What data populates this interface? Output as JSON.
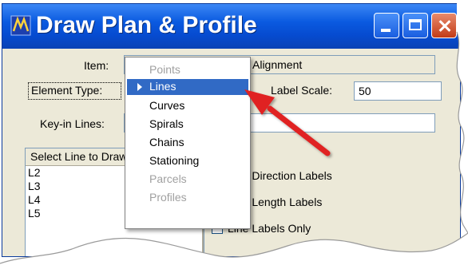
{
  "window": {
    "title": "Draw Plan & Profile",
    "icon": "app-logo-icon",
    "controls": [
      "minimize-icon",
      "maximize-icon",
      "close-icon"
    ]
  },
  "form": {
    "item_label": "Item:",
    "item_value": "Alignment",
    "element_type_label": "Element Type:",
    "label_scale_label": "Label Scale:",
    "label_scale_value": "50",
    "keyin_lines_label": "Key-in Lines:",
    "keyin_lines_value": ""
  },
  "list": {
    "header": "Select Line to Draw",
    "items": [
      "L2",
      "L3",
      "L4",
      "L5"
    ]
  },
  "options": [
    "Line Direction Labels",
    "Line Length Labels",
    "Line Labels Only"
  ],
  "dropdown": {
    "items": [
      {
        "label": "Points",
        "disabled": true
      },
      {
        "label": "Lines",
        "selected": true
      },
      {
        "label": "Curves"
      },
      {
        "label": "Spirals"
      },
      {
        "label": "Chains"
      },
      {
        "label": "Stationing"
      },
      {
        "label": "Parcels",
        "disabled": true
      },
      {
        "label": "Profiles",
        "disabled": true
      }
    ]
  },
  "colors": {
    "titlebar": "#0a5ae0",
    "selection": "#316ac5",
    "arrow": "#e02020",
    "dialog_bg": "#ece9d8"
  }
}
